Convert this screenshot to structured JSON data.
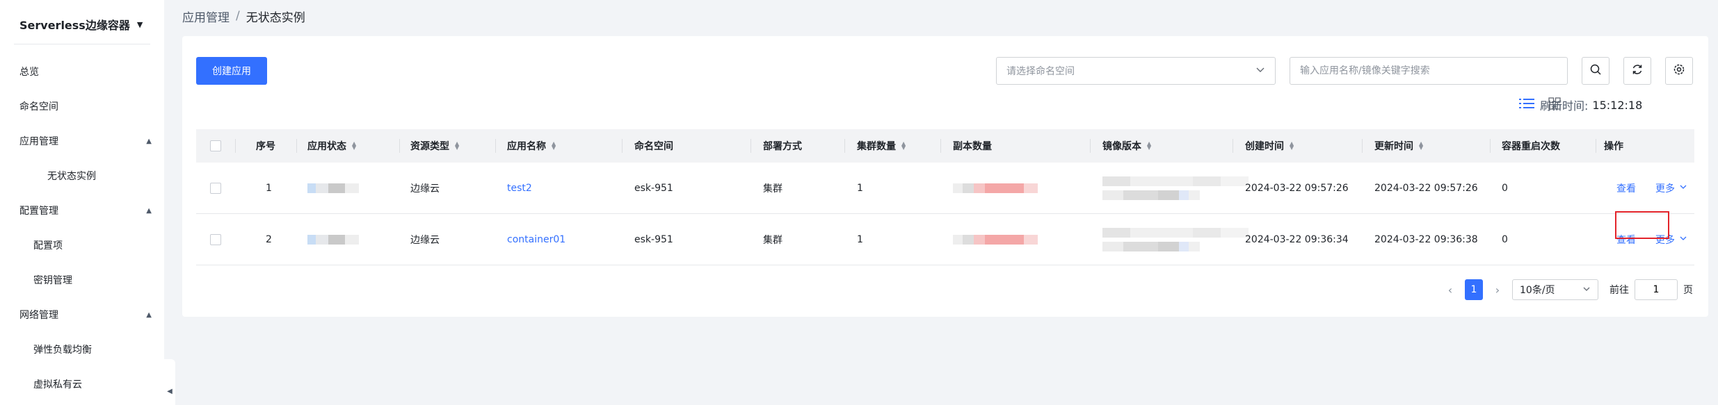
{
  "sidebar": {
    "title": "Serverless边缘容器",
    "items": [
      {
        "label": "总览"
      },
      {
        "label": "命名空间"
      },
      {
        "label": "应用管理"
      },
      {
        "label": "无状态实例"
      },
      {
        "label": "配置管理"
      },
      {
        "label": "配置项"
      },
      {
        "label": "密钥管理"
      },
      {
        "label": "网络管理"
      },
      {
        "label": "弹性负载均衡"
      },
      {
        "label": "虚拟私有云"
      }
    ]
  },
  "breadcrumb": {
    "parent": "应用管理",
    "separator": "/",
    "current": "无状态实例"
  },
  "toolbar": {
    "create_label": "创建应用",
    "namespace_placeholder": "请选择命名空间",
    "search_placeholder": "输入应用名称/镜像关键字搜索",
    "refresh_label": "刷新时间:",
    "refresh_time": "15:12:18"
  },
  "table": {
    "headers": {
      "index": "序号",
      "status": "应用状态",
      "resource_type": "资源类型",
      "app_name": "应用名称",
      "namespace": "命名空间",
      "deploy": "部署方式",
      "cluster_count": "集群数量",
      "replicas": "副本数量",
      "image": "镜像版本",
      "created": "创建时间",
      "updated": "更新时间",
      "restarts": "容器重启次数",
      "actions": "操作"
    },
    "rows": [
      {
        "index": "1",
        "resource_type": "边缘云",
        "app_name": "test2",
        "namespace": "esk-951",
        "deploy": "集群",
        "cluster_count": "1",
        "created": "2024-03-22 09:57:26",
        "updated": "2024-03-22 09:57:26",
        "restarts": "0",
        "view": "查看",
        "more": "更多"
      },
      {
        "index": "2",
        "resource_type": "边缘云",
        "app_name": "container01",
        "namespace": "esk-951",
        "deploy": "集群",
        "cluster_count": "1",
        "created": "2024-03-22 09:36:34",
        "updated": "2024-03-22 09:36:38",
        "restarts": "0",
        "view": "查看",
        "more": "更多"
      }
    ]
  },
  "pagination": {
    "current_page": "1",
    "page_size": "10条/页",
    "goto_prefix": "前往",
    "goto_value": "1",
    "goto_suffix": "页"
  },
  "colors": {
    "primary": "#3370ff",
    "highlight": "#e3242b"
  }
}
